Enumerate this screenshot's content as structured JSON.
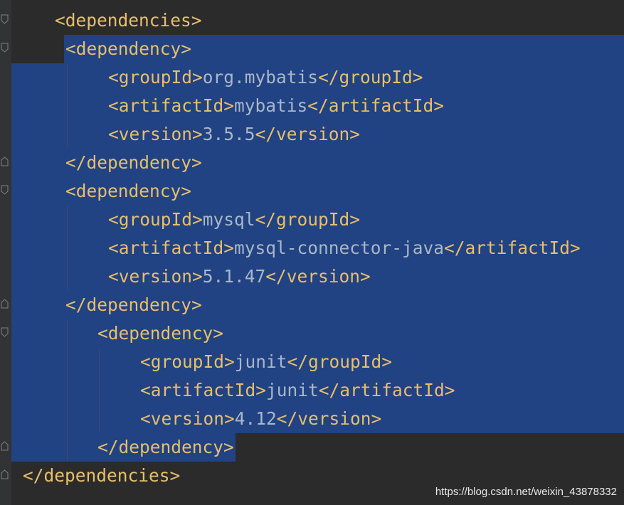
{
  "editor": {
    "language": "xml",
    "colors": {
      "background": "#2b2b2b",
      "selection": "#214283",
      "tag": "#e8bf6a",
      "text": "#a9b7c6",
      "gutter": "#313335"
    },
    "lines": [
      {
        "open": "<dependencies>",
        "value": "",
        "close": ""
      },
      {
        "open": "<dependency>",
        "value": "",
        "close": ""
      },
      {
        "open": "<groupId>",
        "value": "org.mybatis",
        "close": "</groupId>"
      },
      {
        "open": "<artifactId>",
        "value": "mybatis",
        "close": "</artifactId>"
      },
      {
        "open": "<version>",
        "value": "3.5.5",
        "close": "</version>"
      },
      {
        "open": "</dependency>",
        "value": "",
        "close": ""
      },
      {
        "open": "<dependency>",
        "value": "",
        "close": ""
      },
      {
        "open": "<groupId>",
        "value": "mysql",
        "close": "</groupId>"
      },
      {
        "open": "<artifactId>",
        "value": "mysql-connector-java",
        "close": "</artifactId>"
      },
      {
        "open": "<version>",
        "value": "5.1.47",
        "close": "</version>"
      },
      {
        "open": "</dependency>",
        "value": "",
        "close": ""
      },
      {
        "open": "<dependency>",
        "value": "",
        "close": ""
      },
      {
        "open": "<groupId>",
        "value": "junit",
        "close": "</groupId>"
      },
      {
        "open": "<artifactId>",
        "value": "junit",
        "close": "</artifactId>"
      },
      {
        "open": "<version>",
        "value": "4.12",
        "close": "</version>"
      },
      {
        "open": "</dependency>",
        "value": "",
        "close": ""
      },
      {
        "open": "</dependencies>",
        "value": "",
        "close": ""
      }
    ]
  },
  "watermark": "https://blog.csdn.net/weixin_43878332"
}
